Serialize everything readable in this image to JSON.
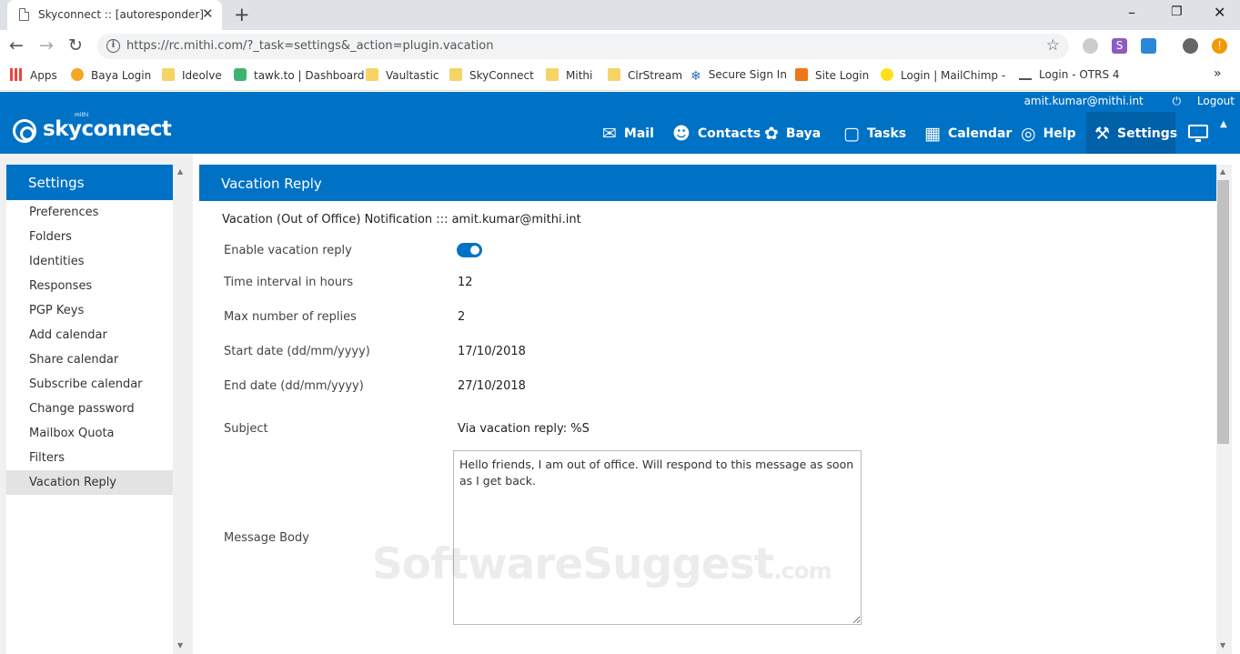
{
  "browser": {
    "tab_title": "Skyconnect :: [autoresponder]",
    "tab_close": "✕",
    "new_tab": "+",
    "url": "https://rc.mithi.com/?_task=settings&_action=plugin.vacation",
    "bookmarks": [
      {
        "label": "Apps",
        "icon": "apps-grid-icon"
      },
      {
        "label": "Baya Login",
        "icon": "bird-icon"
      },
      {
        "label": "Ideolve",
        "icon": "folder-icon"
      },
      {
        "label": "tawk.to | Dashboard",
        "icon": "tawk-icon"
      },
      {
        "label": "Vaultastic",
        "icon": "folder-icon"
      },
      {
        "label": "SkyConnect",
        "icon": "folder-icon"
      },
      {
        "label": "Mithi",
        "icon": "folder-icon"
      },
      {
        "label": "ClrStream",
        "icon": "folder-icon"
      },
      {
        "label": "Secure Sign In",
        "icon": "snowflake-icon"
      },
      {
        "label": "Site Login",
        "icon": "box-icon"
      },
      {
        "label": "Login | MailChimp - ",
        "icon": "mailchimp-icon"
      },
      {
        "label": "Login - OTRS 4",
        "icon": "otrs-icon"
      }
    ],
    "overflow": "»"
  },
  "header": {
    "user": "amit.kumar@mithi.int",
    "logout": "Logout",
    "logo_text": "skyconnect",
    "logo_small": "mithi",
    "nav": [
      {
        "label": "Mail",
        "icon": "mail-icon"
      },
      {
        "label": "Contacts",
        "icon": "contacts-icon"
      },
      {
        "label": "Baya",
        "icon": "bird-icon"
      },
      {
        "label": "Tasks",
        "icon": "tasks-icon"
      },
      {
        "label": "Calendar",
        "icon": "calendar-icon"
      },
      {
        "label": "Help",
        "icon": "help-icon"
      },
      {
        "label": "Settings",
        "icon": "wrench-icon",
        "active": true
      }
    ]
  },
  "sidebar": {
    "title": "Settings",
    "items": [
      {
        "label": "Preferences"
      },
      {
        "label": "Folders"
      },
      {
        "label": "Identities"
      },
      {
        "label": "Responses"
      },
      {
        "label": "PGP Keys"
      },
      {
        "label": "Add calendar"
      },
      {
        "label": "Share calendar"
      },
      {
        "label": "Subscribe calendar"
      },
      {
        "label": "Change password"
      },
      {
        "label": "Mailbox Quota"
      },
      {
        "label": "Filters"
      },
      {
        "label": "Vacation Reply",
        "selected": true
      }
    ]
  },
  "main": {
    "title": "Vacation Reply",
    "notification": "Vacation (Out of Office) Notification ::: amit.kumar@mithi.int",
    "enable_label": "Enable vacation reply",
    "enable_value": true,
    "interval_label": "Time interval in hours",
    "interval_value": "12",
    "max_label": "Max number of replies",
    "max_value": "2",
    "start_label": "Start date (dd/mm/yyyy)",
    "start_value": "17/10/2018",
    "end_label": "End date (dd/mm/yyyy)",
    "end_value": "27/10/2018",
    "subject_label": "Subject",
    "subject_value": "Via vacation reply: %S",
    "body_label": "Message Body",
    "body_value": "Hello friends, I am out of office. Will respond to this message as soon as I get back."
  },
  "watermark": {
    "text": "SoftwareSuggest",
    "suffix": ".com"
  },
  "colors": {
    "brand": "#0072c6",
    "active_nav": "#0060a8",
    "selected_item": "#e3e3e3"
  }
}
